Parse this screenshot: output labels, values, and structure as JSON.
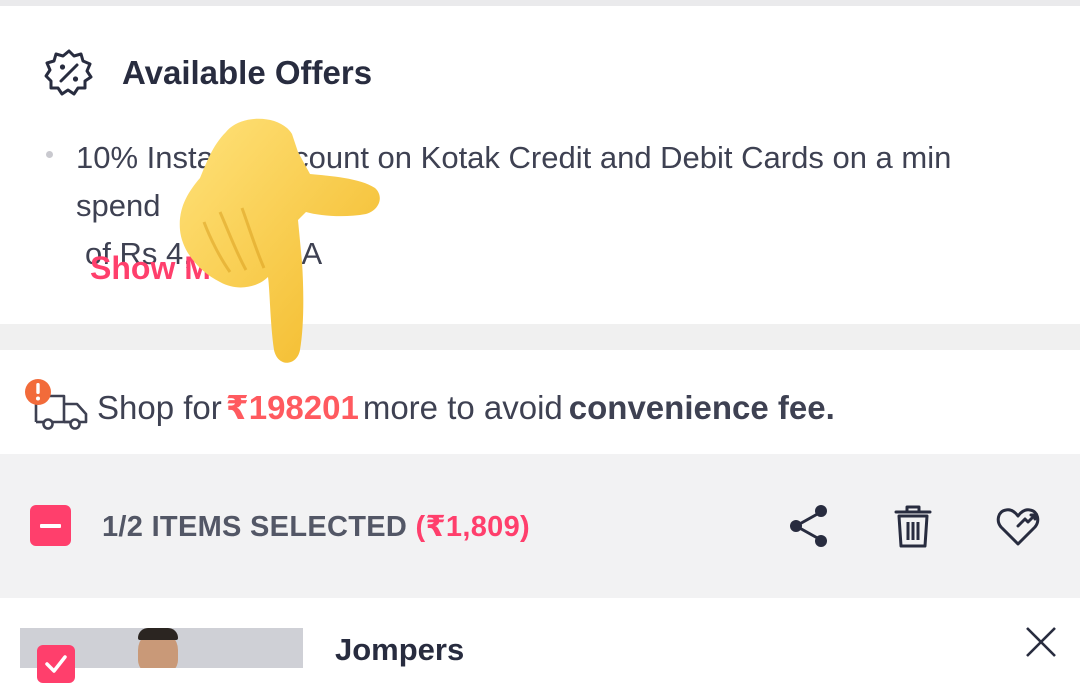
{
  "offers": {
    "title": "Available Offers",
    "offer_line1": "10% Instant Discount on Kotak Credit and Debit Cards on a min spend",
    "offer_line2": "of Rs 4,000. TCA",
    "show_more": "Show More",
    "icon": "discount-badge-icon"
  },
  "fee_notice": {
    "prefix": "Shop for",
    "amount": "₹198201",
    "middle": "more to avoid",
    "bold": "convenience fee.",
    "icon": "delivery-truck-alert-icon"
  },
  "selection": {
    "label": "1/2 ITEMS SELECTED",
    "price": "(₹1,809)",
    "actions": [
      "share-icon",
      "delete-icon",
      "wishlist-icon"
    ]
  },
  "item": {
    "title": "Jompers",
    "selected": true
  },
  "colors": {
    "accent": "#ff3f6c",
    "amount": "#ff5a5f",
    "text": "#3e4152"
  }
}
